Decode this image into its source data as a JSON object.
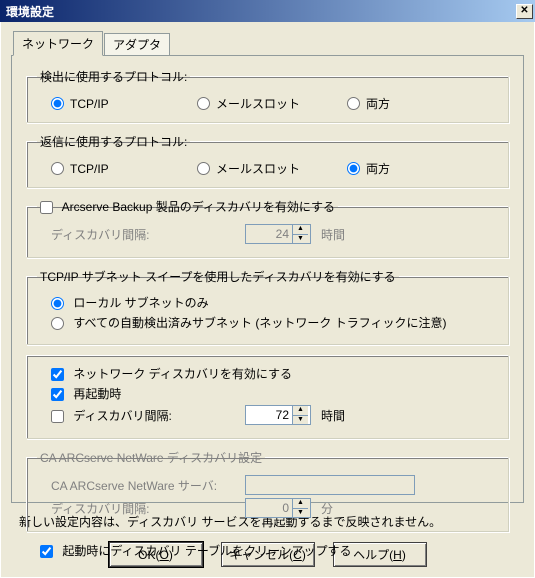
{
  "title": "環境設定",
  "tabs": {
    "network": "ネットワーク",
    "adapter": "アダプタ"
  },
  "detectGroup": {
    "legend": "検出に使用するプロトコル:",
    "opt_tcpip": "TCP/IP",
    "opt_mailslot": "メールスロット",
    "opt_both": "両方",
    "selected": "tcpip"
  },
  "replyGroup": {
    "legend": "返信に使用するプロトコル:",
    "opt_tcpip": "TCP/IP",
    "opt_mailslot": "メールスロット",
    "opt_both": "両方",
    "selected": "both"
  },
  "arcserveProduct": {
    "checkbox_label": "Arcserve Backup 製品のディスカバリを有効にする",
    "checked": false,
    "interval_label": "ディスカバリ間隔:",
    "interval_value": "24",
    "interval_unit": "時間"
  },
  "subnetGroup": {
    "legend": "TCP/IP サブネット スイープを使用したディスカバリを有効にする",
    "opt_local": "ローカル サブネットのみ",
    "opt_all": "すべての自動検出済みサブネット (ネットワーク トラフィックに注意)",
    "selected": "local"
  },
  "networkDiscovery": {
    "enable_label": "ネットワーク ディスカバリを有効にする",
    "enable_checked": true,
    "onreboot_label": "再起動時",
    "onreboot_checked": true,
    "interval_label": "ディスカバリ間隔:",
    "interval_checked": false,
    "interval_value": "72",
    "interval_unit": "時間"
  },
  "netware": {
    "legend": "CA ARCserve NetWare ディスカバリ設定",
    "server_label": "CA ARCserve NetWare サーバ:",
    "server_value": "",
    "interval_label": "ディスカバリ間隔:",
    "interval_value": "0",
    "interval_unit": "分"
  },
  "cleanup": {
    "label": "起動時にディスカバリ テーブルをクリーンアップする",
    "checked": true
  },
  "footer_note": "新しい設定内容は、ディスカバリ サービスを再起動するまで反映されません。",
  "buttons": {
    "ok_pre": "OK(",
    "ok_u": "O",
    "ok_post": ")",
    "cancel_pre": "キャンセル(",
    "cancel_u": "C",
    "cancel_post": ")",
    "help_pre": "ヘルプ(",
    "help_u": "H",
    "help_post": ")"
  }
}
